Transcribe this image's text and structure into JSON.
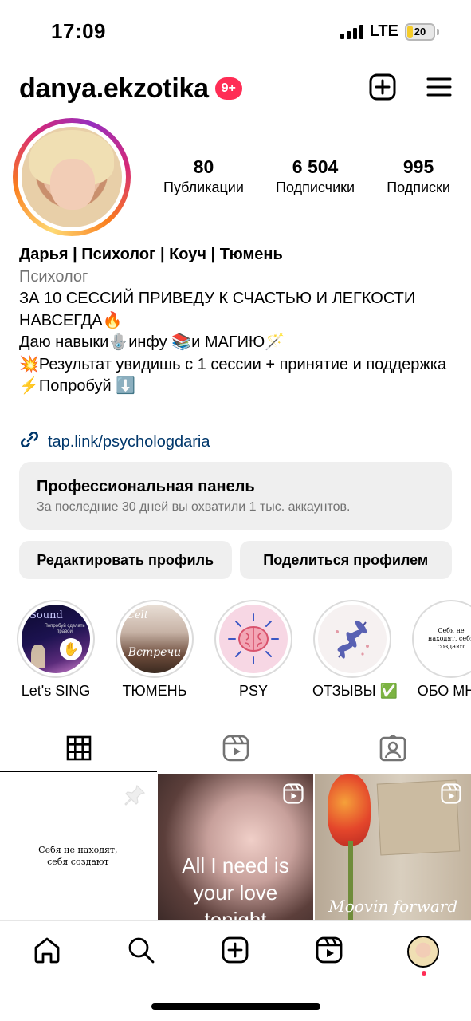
{
  "status": {
    "time": "17:09",
    "network": "LTE",
    "battery": "20"
  },
  "header": {
    "username": "danya.ekzotika",
    "badge": "9+"
  },
  "stats": [
    {
      "value": "80",
      "label": "Публикации"
    },
    {
      "value": "6 504",
      "label": "Подписчики"
    },
    {
      "value": "995",
      "label": "Подписки"
    }
  ],
  "bio": {
    "name": "Дарья | Психолог | Коуч | Тюмень",
    "category": "Психолог",
    "line1": "ЗА 10 СЕССИЙ ПРИВЕДУ К СЧАСТЬЮ И ЛЕГКОСТИ НАВСЕГДА🔥",
    "line2": "Даю навыки🪬инфу 📚и МАГИЮ🪄",
    "line3": "💥Результат увидишь с 1 сессии + принятие и поддержка",
    "line4": "⚡️Попробуй ⬇️",
    "link": "tap.link/psychologdaria"
  },
  "pro_panel": {
    "title": "Профессиональная панель",
    "subtitle": "За последние 30 дней вы охватили 1 тыс. аккаунтов."
  },
  "buttons": {
    "edit": "Редактировать профиль",
    "share": "Поделиться профилем"
  },
  "highlights": [
    {
      "label": "Let's SING",
      "cover_text": "Sound",
      "cover_sub": "Попробуй сделать правой"
    },
    {
      "label": "ТЮМЕНЬ",
      "cover_text": "Встречи",
      "cover_sub": "Celt"
    },
    {
      "label": "PSY"
    },
    {
      "label": "ОТЗЫВЫ ✅"
    },
    {
      "label": "ОБО МНЕ",
      "cover_text": "Себя не находят, себя создают"
    }
  ],
  "grid": [
    {
      "text": "Себя не находят, себя создают"
    },
    {
      "text": "All I need is your love tonight"
    },
    {
      "text": "Moovin forward"
    }
  ],
  "colors": {
    "badge": "#ff2d55",
    "link": "#00376b",
    "panel": "#efefef",
    "muted": "#737373"
  }
}
